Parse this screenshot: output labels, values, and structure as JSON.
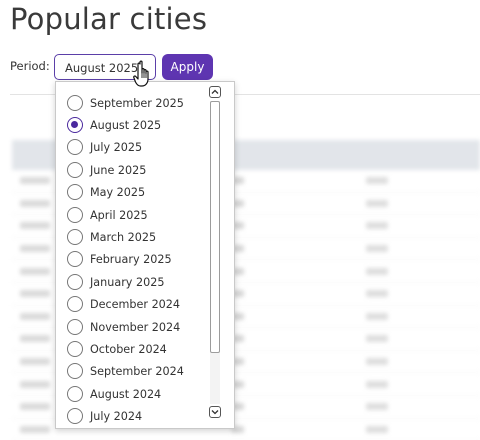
{
  "page": {
    "title": "Popular cities"
  },
  "filter": {
    "period_label": "Period:",
    "selected_value": "August 2025",
    "apply_label": "Apply"
  },
  "dropdown": {
    "options": [
      {
        "label": "September 2025",
        "selected": false
      },
      {
        "label": "August 2025",
        "selected": true
      },
      {
        "label": "July 2025",
        "selected": false
      },
      {
        "label": "June 2025",
        "selected": false
      },
      {
        "label": "May 2025",
        "selected": false
      },
      {
        "label": "April 2025",
        "selected": false
      },
      {
        "label": "March 2025",
        "selected": false
      },
      {
        "label": "February 2025",
        "selected": false
      },
      {
        "label": "January 2025",
        "selected": false
      },
      {
        "label": "December 2024",
        "selected": false
      },
      {
        "label": "November 2024",
        "selected": false
      },
      {
        "label": "October 2024",
        "selected": false
      },
      {
        "label": "September 2024",
        "selected": false
      },
      {
        "label": "August 2024",
        "selected": false
      },
      {
        "label": "July 2024",
        "selected": false
      }
    ],
    "scroll_up_icon": "chevron-up-icon",
    "scroll_down_icon": "chevron-down-icon"
  },
  "colors": {
    "accent": "#5e35b1",
    "select_border": "#5b3fa8"
  }
}
